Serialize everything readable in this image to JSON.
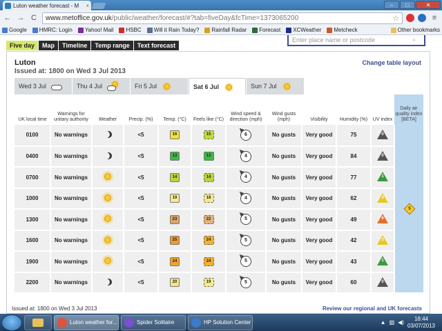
{
  "browser": {
    "tab_title": "Luton weather forecast - M",
    "tab_close": "×",
    "url_host": "www.metoffice.gov.uk",
    "url_path": "/public/weather/forecast/#?tab=fiveDay&fcTime=1373065200",
    "window_buttons": {
      "minimize": "–",
      "maximize": "□",
      "close": "✕"
    },
    "nav": {
      "back": "←",
      "forward": "→",
      "reload": "C"
    }
  },
  "bookmarks": [
    {
      "label": "Google",
      "color": "#4a7bd2"
    },
    {
      "label": "HMRC: Login",
      "color": "#4a7bd2"
    },
    {
      "label": "Yahoo! Mail",
      "color": "#7b2a9e"
    },
    {
      "label": "HSBC",
      "color": "#d42a2a"
    },
    {
      "label": "Will it Rain Today?",
      "color": "#5b6f95"
    },
    {
      "label": "Rainfall Radar",
      "color": "#d6a21a"
    },
    {
      "label": "Forecast",
      "color": "#2d6b3a"
    },
    {
      "label": "XCWeather",
      "color": "#1a2e8a"
    },
    {
      "label": "Metcheck",
      "color": "#c85b2a"
    }
  ],
  "other_bookmarks": "Other bookmarks",
  "main_tabs": [
    "Five day",
    "Map",
    "Timeline",
    "Temp range",
    "Text forecast"
  ],
  "search_placeholder": "Enter place name or postcode",
  "search_clear": "×",
  "location": "Luton",
  "issued": "Issued at: 1800 on Wed 3 Jul 2013",
  "change_layout": "Change table layout",
  "days": [
    {
      "label": "Wed 3 Jul",
      "icon": "cloud-icon"
    },
    {
      "label": "Thu 4 Jul",
      "icon": "sun-cloud-icon"
    },
    {
      "label": "Fri 5 Jul",
      "icon": "sun-icon"
    },
    {
      "label": "Sat 6 Jul",
      "icon": "sun-icon"
    },
    {
      "label": "Sun 7 Jul",
      "icon": "sun-icon"
    }
  ],
  "columns": [
    "UK local time",
    "Warnings for unitary authority",
    "Weather",
    "Precip. (%)",
    "Temp. (°C)",
    "Feels like (°C)",
    "Wind speed & direction (mph)",
    "Wind gusts (mph)",
    "Visibility",
    "Humidity (%)",
    "UV index",
    "Daily air quality index [BETA]"
  ],
  "rows": [
    {
      "time": "0100",
      "warn": "No warnings",
      "wx": "moon",
      "precip": "<5",
      "temp": "16",
      "temp_color": "#f0e23a",
      "feels": "15",
      "feels_color": "#c4da3e",
      "wind": "6",
      "gusts": "No gusts",
      "vis": "Very good",
      "hum": "75",
      "uv": "0",
      "uv_color": "#555555"
    },
    {
      "time": "0400",
      "warn": "No warnings",
      "wx": "moon",
      "precip": "<5",
      "temp": "13",
      "temp_color": "#42b649",
      "feels": "13",
      "feels_color": "#42b649",
      "wind": "4",
      "gusts": "No gusts",
      "vis": "Very good",
      "hum": "84",
      "uv": "0",
      "uv_color": "#555555"
    },
    {
      "time": "0700",
      "warn": "No warnings",
      "wx": "sun",
      "precip": "<5",
      "temp": "14",
      "temp_color": "#b9d63c",
      "feels": "14",
      "feels_color": "#b9d63c",
      "wind": "4",
      "gusts": "No gusts",
      "vis": "Very good",
      "hum": "77",
      "uv": "1",
      "uv_color": "#3c9a3c"
    },
    {
      "time": "1000",
      "warn": "No warnings",
      "wx": "sun",
      "precip": "<5",
      "temp": "19",
      "temp_color": "#f3ea8e",
      "feels": "18",
      "feels_color": "#f3ea8e",
      "wind": "4",
      "gusts": "No gusts",
      "vis": "Very good",
      "hum": "62",
      "uv": "3",
      "uv_color": "#e8c81e"
    },
    {
      "time": "1300",
      "warn": "No warnings",
      "wx": "sun",
      "precip": "<5",
      "temp": "23",
      "temp_color": "#d9a56a",
      "feels": "22",
      "feels_color": "#e2b27a",
      "wind": "5",
      "gusts": "No gusts",
      "vis": "Very good",
      "hum": "49",
      "uv": "6",
      "uv_color": "#e0702a"
    },
    {
      "time": "1600",
      "warn": "No warnings",
      "wx": "sun",
      "precip": "<5",
      "temp": "25",
      "temp_color": "#f09a2e",
      "feels": "24",
      "feels_color": "#f3b12e",
      "wind": "5",
      "gusts": "No gusts",
      "vis": "Very good",
      "hum": "42",
      "uv": "3",
      "uv_color": "#e8c81e"
    },
    {
      "time": "1900",
      "warn": "No warnings",
      "wx": "sun",
      "precip": "<5",
      "temp": "24",
      "temp_color": "#f3a42e",
      "feels": "24",
      "feels_color": "#f3b12e",
      "wind": "5",
      "gusts": "No gusts",
      "vis": "Very good",
      "hum": "43",
      "uv": "1",
      "uv_color": "#3c9a3c"
    },
    {
      "time": "2200",
      "warn": "No warnings",
      "wx": "moon",
      "precip": "<5",
      "temp": "20",
      "temp_color": "#f3e48a",
      "feels": "19",
      "feels_color": "#f3ea8e",
      "wind": "5",
      "gusts": "No gusts",
      "vis": "Very good",
      "hum": "60",
      "uv": "0",
      "uv_color": "#555555"
    }
  ],
  "air_quality": "5",
  "footer_issued": "Issued at: 1800 on Wed 3 Jul 2013",
  "footer_link": "Review our regional and UK forecasts",
  "taskbar": {
    "items": [
      {
        "label": "Luton weather for...",
        "color": "#e0533a"
      },
      {
        "label": "Spider Solitaire",
        "color": "#7a4fd0"
      },
      {
        "label": "HP Solution Center",
        "color": "#3c7acb"
      }
    ],
    "time": "18:44",
    "date": "03/07/2013"
  }
}
